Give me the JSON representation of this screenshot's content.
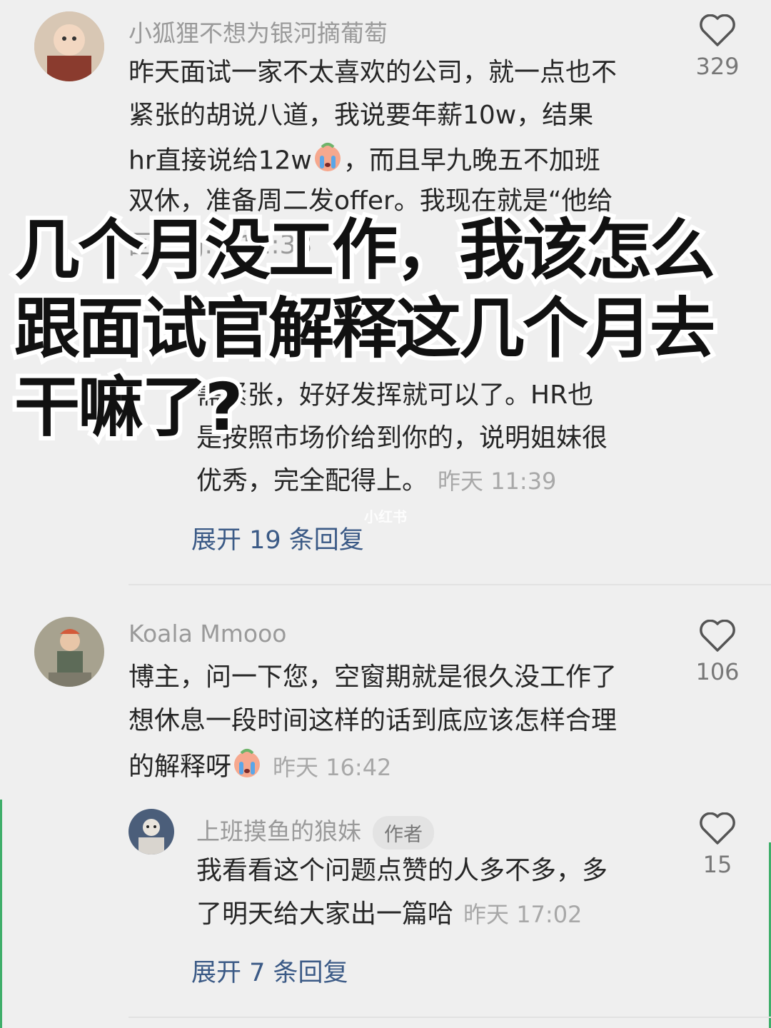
{
  "comments": [
    {
      "username": "小狐狸不想为银河摘葡萄",
      "lines": [
        "昨天面试一家不太喜欢的公司，就一点也不",
        "紧张的胡说八道，我说要年薪10w，结果",
        "hr直接说给12w",
        "，而且早九晚五不加班",
        "双休，准备周二发offer。我现在就是“他给"
      ],
      "partial_line": "回… g… 11:33",
      "likes": "329",
      "icon": "heart-outline-icon"
    },
    {
      "username": "Koala Mmooo",
      "lines": [
        "博主，问一下您，空窗期就是很久没工作了",
        "想休息一段时间这样的话到底应该怎样合理",
        "的解释呀"
      ],
      "time": "昨天 16:42",
      "likes": "106"
    }
  ],
  "reply1": {
    "lines": [
      "需紧张，好好发挥就可以了。HR也",
      "是按照市场价给到你的，说明姐妹很",
      "优秀，完全配得上。"
    ],
    "time": "昨天 11:39",
    "expand": "展开 19 条回复"
  },
  "reply2": {
    "username": "上班摸鱼的狼妹",
    "badge": "作者",
    "lines": [
      "我看看这个问题点赞的人多不多，多",
      "了明天给大家出一篇哈"
    ],
    "time": "昨天 17:02",
    "likes": "15",
    "expand": "展开 7 条回复"
  },
  "overlay_title": [
    "几个月没工作，我该怎么",
    "跟面试官解释这几个月去",
    "干嘛了?"
  ],
  "watermark": "小红书",
  "colors": {
    "background": "#efefef",
    "link": "#3b5a86",
    "muted": "#9a9a9a"
  }
}
